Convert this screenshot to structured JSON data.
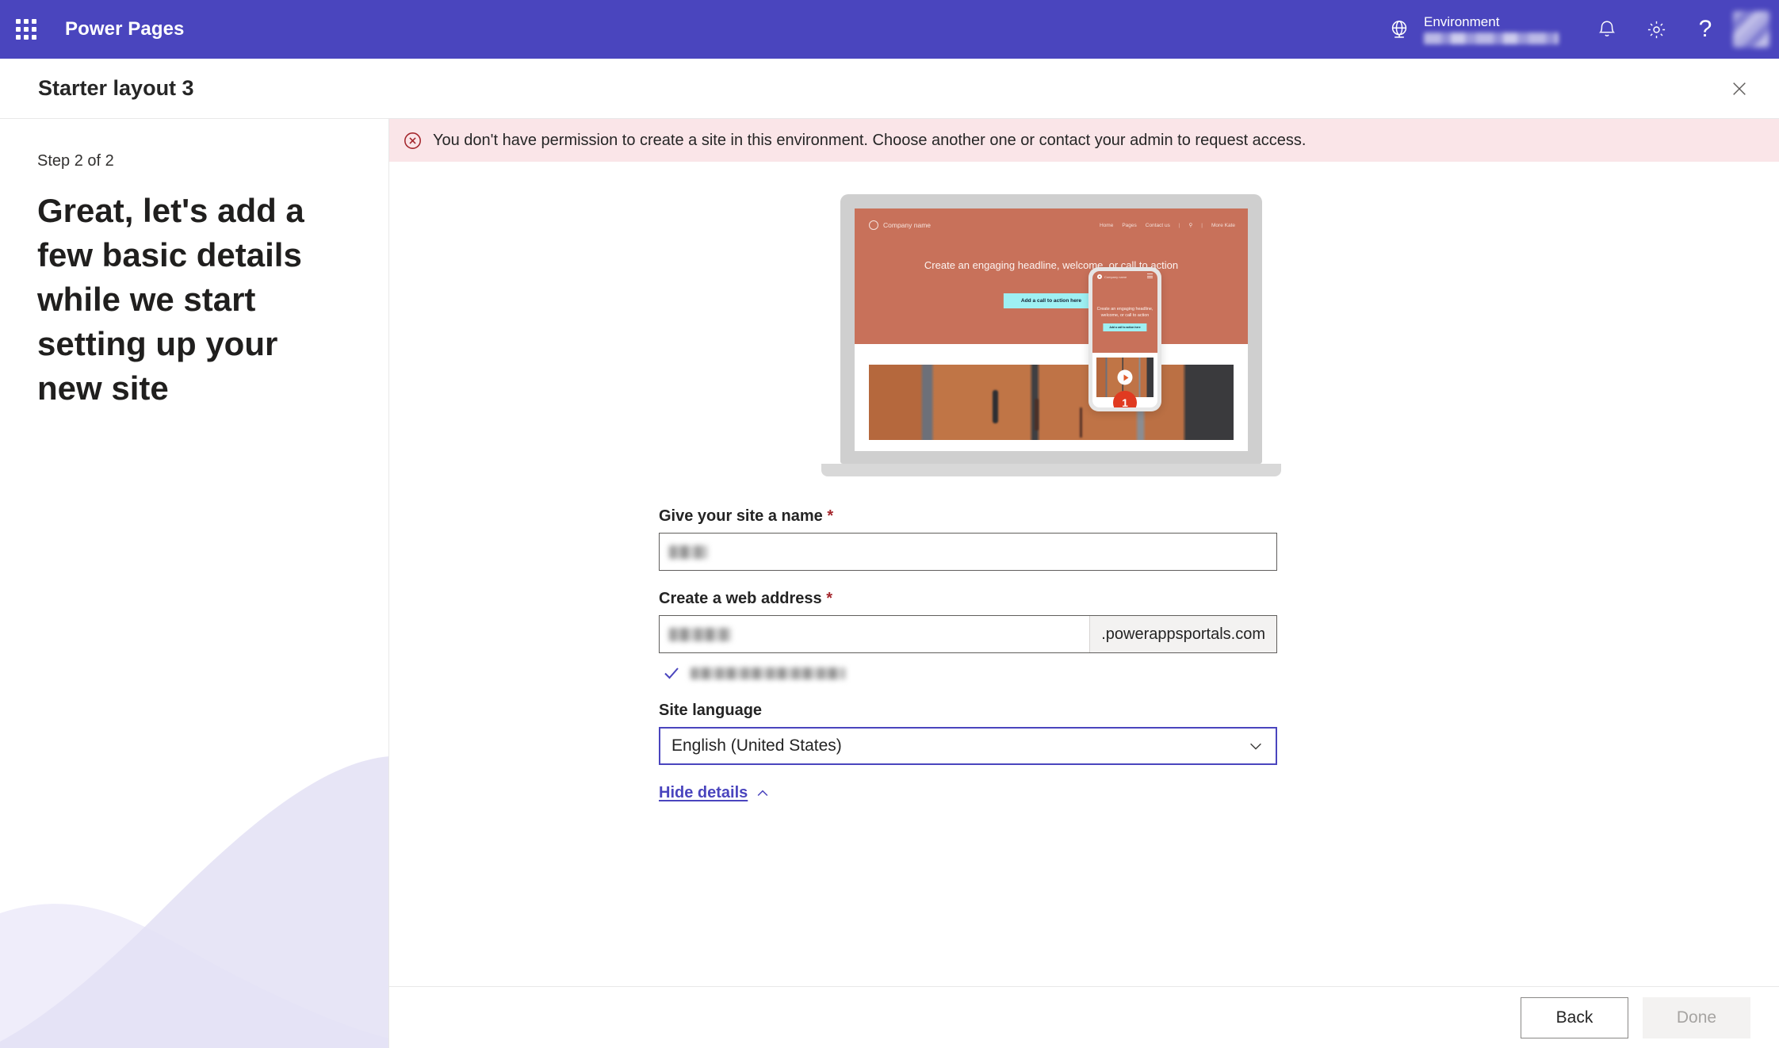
{
  "suite": {
    "app_title": "Power Pages",
    "waffle_icon": "app-launcher-waffle-icon",
    "globe_icon": "globe-icon",
    "environment_label": "Environment",
    "environment_value": "",
    "notifications_icon": "bell-icon",
    "settings_icon": "gear-icon",
    "help_icon": "question-mark-icon",
    "avatar_icon": "user-avatar"
  },
  "dialog": {
    "title": "Starter layout 3",
    "close_icon": "close-icon"
  },
  "banner": {
    "icon": "error-circle-x-icon",
    "message": "You don't have permission to create a site in this environment. Choose another one or contact your admin to request access.",
    "background": "#FAE5E8",
    "icon_color": "#A4262C"
  },
  "side": {
    "step": "Step 2 of 2",
    "heading": "Great, let's add a few basic details while we start setting up your new site"
  },
  "preview": {
    "company_name": "Company name",
    "nav_items": [
      "Home",
      "Pages",
      "Contact us"
    ],
    "nav_search_icon": "search-icon",
    "nav_account": "More Kate",
    "headline": "Create an engaging headline, welcome, or call to action",
    "cta_label": "Add a call to action here",
    "hero_color": "#C8715A",
    "cta_color": "#9EF0F3",
    "mobile": {
      "company_name": "Company name",
      "headline": "Create an engaging headline, welcome, or call to action",
      "cta_label": "Add a call to action here",
      "play_icon": "play-icon",
      "badge_number": "1",
      "badge_color": "#E03A20"
    }
  },
  "form": {
    "site_name": {
      "label": "Give your site a name",
      "required_marker": "*",
      "value": ""
    },
    "web_address": {
      "label": "Create a web address",
      "required_marker": "*",
      "value": "",
      "suffix": ".powerappsportals.com",
      "validation_icon": "checkmark-icon",
      "validation_text": ""
    },
    "site_language": {
      "label": "Site language",
      "value": "English (United States)",
      "chevron_icon": "chevron-down-icon",
      "focus_color": "#4A45BE"
    },
    "details_toggle": {
      "label": "Hide details",
      "icon": "chevron-up-icon"
    }
  },
  "footer": {
    "back_label": "Back",
    "done_label": "Done",
    "done_disabled": true
  },
  "theme": {
    "brand_purple": "#4A45BE",
    "error_red": "#A4262C",
    "wave_color": "#E6E3F7"
  }
}
